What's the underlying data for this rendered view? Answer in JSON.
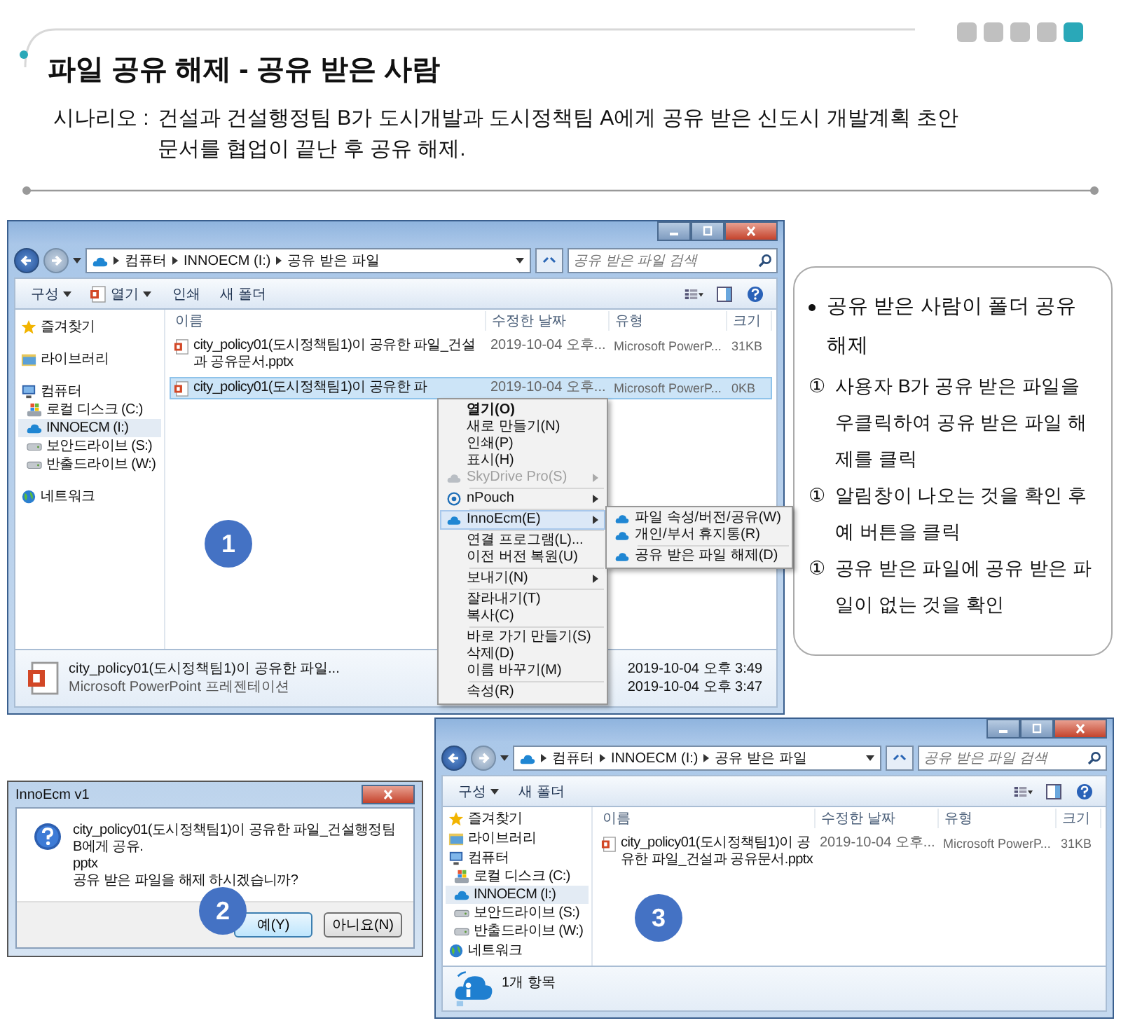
{
  "slide": {
    "title": "파일 공유 해제 - 공유 받은 사람",
    "scenario_label": "시나리오 :",
    "scenario_text": "건설과 건설행정팀 B가 도시개발과 도시정책팀 A에게 공유 받은 신도시 개발계획 초안\n문서를 협업이 끝난 후 공유 해제.",
    "pages": [
      {
        "selected": false
      },
      {
        "selected": false
      },
      {
        "selected": false
      },
      {
        "selected": false
      },
      {
        "selected": true
      }
    ]
  },
  "explorer_1": {
    "step": "1",
    "breadcrumb": [
      "컴퓨터",
      "INNOECM (I:)",
      "공유 받은 파일"
    ],
    "search_placeholder": "공유 받은 파일 검색",
    "toolbar": [
      {
        "label": "구성",
        "kind": "plain",
        "dropdown": true
      },
      {
        "label": "열기",
        "kind": "open",
        "dropdown": true
      },
      {
        "label": "인쇄",
        "kind": "plain",
        "dropdown": false
      },
      {
        "label": "새 폴더",
        "kind": "plain",
        "dropdown": false
      }
    ],
    "nav": [
      {
        "label": "즐겨찾기",
        "kind": "favorites",
        "selected": false
      },
      {
        "label": "라이브러리",
        "kind": "libraries",
        "selected": false
      },
      {
        "label": "컴퓨터",
        "kind": "computer",
        "selected": false,
        "children": [
          {
            "label": "로컬 디스크 (C:)",
            "kind": "disk",
            "selected": false
          },
          {
            "label": "INNOECM (I:)",
            "kind": "cloud",
            "selected": true
          },
          {
            "label": "보안드라이브 (S:)",
            "kind": "drive",
            "selected": false
          },
          {
            "label": "반출드라이브 (W:)",
            "kind": "drive",
            "selected": false
          }
        ]
      },
      {
        "label": "네트워크",
        "kind": "network",
        "selected": false
      }
    ],
    "columns": [
      "이름",
      "수정한 날짜",
      "유형",
      "크기"
    ],
    "rows": [
      {
        "name": "city_policy01(도시정책팀1)이 공유한 파일_건설과 공유문서.pptx",
        "date": "2019-10-04 오후...",
        "type": "Microsoft PowerP...",
        "size": "31KB",
        "selected": false
      },
      {
        "name": "city_policy01(도시정책팀1)이 공유한 파",
        "date": "2019-10-04 오후...",
        "type": "Microsoft PowerP...",
        "size": "0KB",
        "selected": true
      }
    ],
    "details": {
      "name": "city_policy01(도시정책팀1)이 공유한 파일...",
      "type": "Microsoft PowerPoint 프레젠테이션",
      "values": [
        "2019-10-04 오후 3:49",
        "2019-10-04 오후 3:47"
      ]
    },
    "context_menu": {
      "groups": [
        [
          {
            "label": "열기(O)",
            "kind": "plain",
            "default": true,
            "disabled": false,
            "has_submenu": false,
            "selected": false
          },
          {
            "label": "새로 만들기(N)",
            "kind": "plain",
            "default": false,
            "disabled": false,
            "has_submenu": false,
            "selected": false
          },
          {
            "label": "인쇄(P)",
            "kind": "plain",
            "default": false,
            "disabled": false,
            "has_submenu": false,
            "selected": false
          },
          {
            "label": "표시(H)",
            "kind": "plain",
            "default": false,
            "disabled": false,
            "has_submenu": false,
            "selected": false
          },
          {
            "label": "SkyDrive Pro(S)",
            "kind": "skydrive",
            "default": false,
            "disabled": true,
            "has_submenu": true,
            "selected": false
          }
        ],
        [
          {
            "label": "nPouch",
            "kind": "pouch",
            "default": false,
            "disabled": false,
            "has_submenu": true,
            "selected": false
          }
        ],
        [
          {
            "label": "InnoEcm(E)",
            "kind": "cloud",
            "default": false,
            "disabled": false,
            "has_submenu": true,
            "selected": true
          }
        ],
        [
          {
            "label": "연결 프로그램(L)...",
            "kind": "plain",
            "default": false,
            "disabled": false,
            "has_submenu": false,
            "selected": false
          },
          {
            "label": "이전 버전 복원(U)",
            "kind": "plain",
            "default": false,
            "disabled": false,
            "has_submenu": false,
            "selected": false
          }
        ],
        [
          {
            "label": "보내기(N)",
            "kind": "plain",
            "default": false,
            "disabled": false,
            "has_submenu": true,
            "selected": false
          }
        ],
        [
          {
            "label": "잘라내기(T)",
            "kind": "plain",
            "default": false,
            "disabled": false,
            "has_submenu": false,
            "selected": false
          },
          {
            "label": "복사(C)",
            "kind": "plain",
            "default": false,
            "disabled": false,
            "has_submenu": false,
            "selected": false
          }
        ],
        [
          {
            "label": "바로 가기 만들기(S)",
            "kind": "plain",
            "default": false,
            "disabled": false,
            "has_submenu": false,
            "selected": false
          },
          {
            "label": "삭제(D)",
            "kind": "plain",
            "default": false,
            "disabled": false,
            "has_submenu": false,
            "selected": false
          },
          {
            "label": "이름 바꾸기(M)",
            "kind": "plain",
            "default": false,
            "disabled": false,
            "has_submenu": false,
            "selected": false
          }
        ],
        [
          {
            "label": "속성(R)",
            "kind": "plain",
            "default": false,
            "disabled": false,
            "has_submenu": false,
            "selected": false
          }
        ]
      ],
      "submenu": {
        "groups": [
          [
            {
              "label": "파일 속성/버전/공유(W)",
              "selected": false
            },
            {
              "label": "개인/부서 휴지통(R)",
              "selected": false
            }
          ],
          [
            {
              "label": "공유 받은 파일 해제(D)",
              "selected": false
            }
          ]
        ]
      }
    }
  },
  "notes": {
    "heading": "공유 받은 사람이 폴더 공유 해제",
    "steps": [
      {
        "marker": "①",
        "text": "사용자 B가 공유 받은 파일을 우클릭하여 공유 받은 파일 해제를 클릭"
      },
      {
        "marker": "①",
        "text": "알림창이 나오는 것을 확인 후 예 버튼을 클릭"
      },
      {
        "marker": "①",
        "text": "공유 받은 파일에 공유 받은 파일이 없는 것을 확인"
      }
    ]
  },
  "dialog": {
    "step": "2",
    "title": "InnoEcm v1",
    "message": "city_policy01(도시정책팀1)이 공유한 파일_건설행정팀 B에게 공유.\npptx\n공유 받은 파일을 해제 하시겠습니까?",
    "buttons": [
      {
        "label": "예(Y)",
        "selected": true
      },
      {
        "label": "아니요(N)",
        "selected": false
      }
    ]
  },
  "explorer_2": {
    "step": "3",
    "breadcrumb": [
      "컴퓨터",
      "INNOECM (I:)",
      "공유 받은 파일"
    ],
    "search_placeholder": "공유 받은 파일 검색",
    "toolbar": [
      {
        "label": "구성",
        "kind": "plain",
        "dropdown": true
      },
      {
        "label": "새 폴더",
        "kind": "plain",
        "dropdown": false
      }
    ],
    "nav": [
      {
        "label": "즐겨찾기",
        "kind": "favorites",
        "selected": false
      },
      {
        "label": "라이브러리",
        "kind": "libraries",
        "selected": false
      },
      {
        "label": "컴퓨터",
        "kind": "computer",
        "selected": false,
        "children": [
          {
            "label": "로컬 디스크 (C:)",
            "kind": "disk",
            "selected": false
          },
          {
            "label": "INNOECM (I:)",
            "kind": "cloud",
            "selected": true
          },
          {
            "label": "보안드라이브 (S:)",
            "kind": "drive",
            "selected": false
          },
          {
            "label": "반출드라이브 (W:)",
            "kind": "drive",
            "selected": false
          }
        ]
      },
      {
        "label": "네트워크",
        "kind": "network",
        "selected": false
      }
    ],
    "columns": [
      "이름",
      "수정한 날짜",
      "유형",
      "크기"
    ],
    "rows": [
      {
        "name": "city_policy01(도시정책팀1)이 공유한 파일_건설과 공유문서.pptx",
        "date": "2019-10-04 오후...",
        "type": "Microsoft PowerP...",
        "size": "31KB",
        "selected": false
      }
    ],
    "status": {
      "text": "1개 항목"
    }
  }
}
